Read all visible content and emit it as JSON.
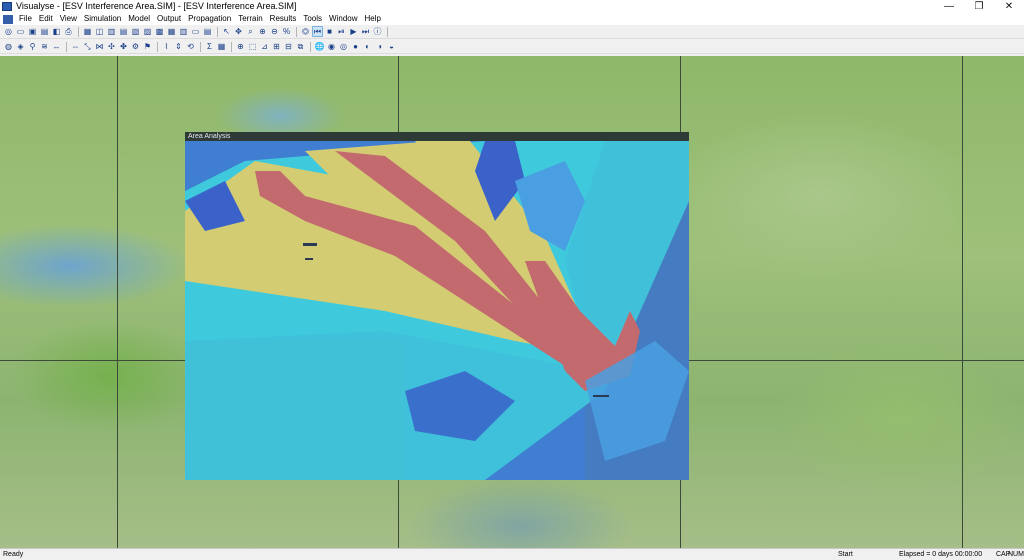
{
  "window": {
    "title": "Visualyse - [ESV Interference Area.SIM] - [ESV Interference Area.SIM]",
    "minimize": "—",
    "restore": "❐",
    "close": "✕"
  },
  "menu": {
    "items": [
      "File",
      "Edit",
      "View",
      "Simulation",
      "Model",
      "Output",
      "Propagation",
      "Terrain",
      "Results",
      "Tools",
      "Window",
      "Help"
    ]
  },
  "toolbar1": {
    "buttons": [
      {
        "name": "new-button",
        "glyph": "◎"
      },
      {
        "name": "open-button",
        "glyph": "▭"
      },
      {
        "name": "save-button",
        "glyph": "▣"
      },
      {
        "name": "save-as-button",
        "glyph": "▤"
      },
      {
        "name": "preview-button",
        "glyph": "◧"
      },
      {
        "name": "print-button",
        "glyph": "⎙"
      },
      {
        "name": "layout-1-button",
        "glyph": "▦"
      },
      {
        "name": "layout-2-button",
        "glyph": "◫"
      },
      {
        "name": "layout-3-button",
        "glyph": "▥"
      },
      {
        "name": "layout-4-button",
        "glyph": "▤"
      },
      {
        "name": "layout-5-button",
        "glyph": "▧"
      },
      {
        "name": "layout-6-button",
        "glyph": "▨"
      },
      {
        "name": "layout-7-button",
        "glyph": "▩"
      },
      {
        "name": "layout-8-button",
        "glyph": "▦"
      },
      {
        "name": "layout-9-button",
        "glyph": "▥"
      },
      {
        "name": "layout-10-button",
        "glyph": "▭"
      },
      {
        "name": "layout-11-button",
        "glyph": "▤"
      },
      {
        "name": "pointer-button",
        "glyph": "↖"
      },
      {
        "name": "move-button",
        "glyph": "✥"
      },
      {
        "name": "zoom-area-button",
        "glyph": "⌕"
      },
      {
        "name": "zoom-in-button",
        "glyph": "⊕"
      },
      {
        "name": "zoom-out-button",
        "glyph": "⊖"
      },
      {
        "name": "zoom-100-button",
        "glyph": "%"
      },
      {
        "name": "reset-button",
        "glyph": "⏣"
      },
      {
        "name": "rewind-button",
        "glyph": "⏮"
      },
      {
        "name": "stop-button",
        "glyph": "■"
      },
      {
        "name": "step-button",
        "glyph": "⏯"
      },
      {
        "name": "run-button",
        "glyph": "▶"
      },
      {
        "name": "fast-forward-button",
        "glyph": "⏭"
      },
      {
        "name": "info-button",
        "glyph": "ⓘ"
      }
    ]
  },
  "toolbar2": {
    "buttons": [
      {
        "name": "antenna-button",
        "glyph": "◍"
      },
      {
        "name": "station-button",
        "glyph": "◈"
      },
      {
        "name": "link-button",
        "glyph": "⚲"
      },
      {
        "name": "carrier-button",
        "glyph": "≋"
      },
      {
        "name": "beam-button",
        "glyph": "↔"
      },
      {
        "name": "interference-button",
        "glyph": "⇔"
      },
      {
        "name": "path-button",
        "glyph": "⤡"
      },
      {
        "name": "group-button",
        "glyph": "⋈"
      },
      {
        "name": "area-button",
        "glyph": "✣"
      },
      {
        "name": "satellite-button",
        "glyph": "✤"
      },
      {
        "name": "orbit-button",
        "glyph": "⚙"
      },
      {
        "name": "ground-button",
        "glyph": "⚑"
      },
      {
        "name": "trace-button",
        "glyph": "⌇"
      },
      {
        "name": "scale-button",
        "glyph": "⇕"
      },
      {
        "name": "rotate-button",
        "glyph": "⟲"
      },
      {
        "name": "sum-button",
        "glyph": "Σ"
      },
      {
        "name": "table-button",
        "glyph": "▦"
      },
      {
        "name": "map-zoom-button",
        "glyph": "⊕"
      },
      {
        "name": "map-select-button",
        "glyph": "⬚"
      },
      {
        "name": "map-measure-button",
        "glyph": "⊿"
      },
      {
        "name": "map-grid-button",
        "glyph": "⊞"
      },
      {
        "name": "map-coast-button",
        "glyph": "⊟"
      },
      {
        "name": "map-terrain-button",
        "glyph": "⧉"
      },
      {
        "name": "globe-1-button",
        "glyph": "🌐"
      },
      {
        "name": "globe-2-button",
        "glyph": "◉"
      },
      {
        "name": "globe-3-button",
        "glyph": "◎"
      },
      {
        "name": "globe-4-button",
        "glyph": "●"
      },
      {
        "name": "globe-5-button",
        "glyph": "◐"
      },
      {
        "name": "globe-6-button",
        "glyph": "◑"
      },
      {
        "name": "globe-7-button",
        "glyph": "◒"
      }
    ]
  },
  "area_window": {
    "title": "Area Analysis"
  },
  "colors": {
    "deep_blue": "#3a62c8",
    "blue": "#3f7ed0",
    "light_blue": "#4a9fe2",
    "cyan": "#3fc9dc",
    "yellow": "#d3cc73",
    "red": "#c26a6e"
  },
  "status": {
    "ready": "Ready",
    "start": "Start",
    "elapsed": "Elapsed = 0 days 00:00:00",
    "cap": "CAP",
    "num": "NUM"
  }
}
